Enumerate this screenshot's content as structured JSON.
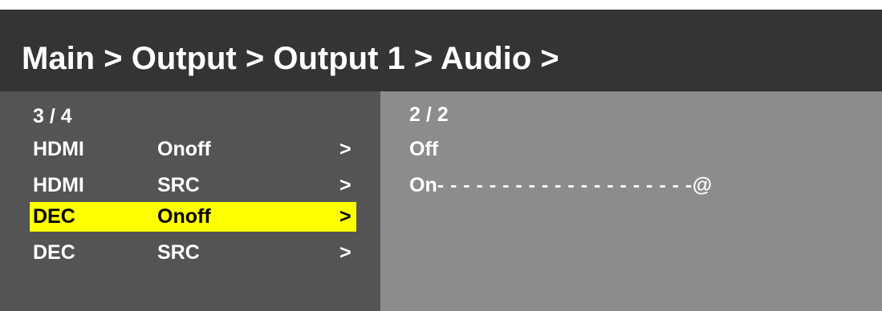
{
  "header": {
    "breadcrumb": "Main > Output > Output 1 > Audio >"
  },
  "left_pane": {
    "counter": "3 / 4",
    "items": [
      {
        "col1": "HDMI",
        "col2": "Onoff",
        "arrow": ">",
        "selected": false
      },
      {
        "col1": "HDMI",
        "col2": "SRC",
        "arrow": ">",
        "selected": false
      },
      {
        "col1": "DEC",
        "col2": "Onoff",
        "arrow": ">",
        "selected": true
      },
      {
        "col1": "DEC",
        "col2": "SRC",
        "arrow": ">",
        "selected": false
      }
    ]
  },
  "right_pane": {
    "counter": "2 / 2",
    "options": [
      {
        "label": "Off",
        "leader": "",
        "marker": ""
      },
      {
        "label": "On",
        "leader": " - - - - - - - - - - - - - - - - - - - - ",
        "marker": "@"
      }
    ]
  },
  "colors": {
    "header_bg": "#343434",
    "left_bg": "#545454",
    "right_bg": "#8c8c8c",
    "highlight": "#ffff00"
  }
}
